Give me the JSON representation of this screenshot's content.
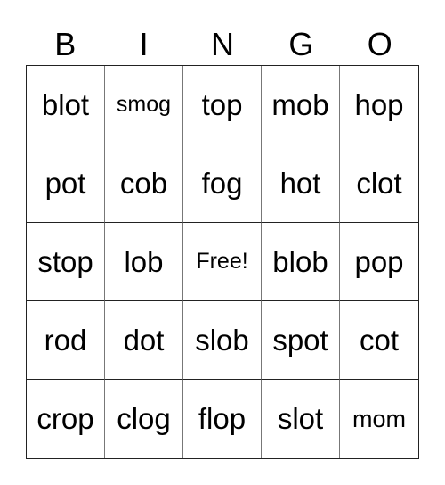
{
  "header": [
    "B",
    "I",
    "N",
    "G",
    "O"
  ],
  "rows": [
    [
      "blot",
      "smog",
      "top",
      "mob",
      "hop"
    ],
    [
      "pot",
      "cob",
      "fog",
      "hot",
      "clot"
    ],
    [
      "stop",
      "lob",
      "Free!",
      "blob",
      "pop"
    ],
    [
      "rod",
      "dot",
      "slob",
      "spot",
      "cot"
    ],
    [
      "crop",
      "clog",
      "flop",
      "slot",
      "mom"
    ]
  ]
}
